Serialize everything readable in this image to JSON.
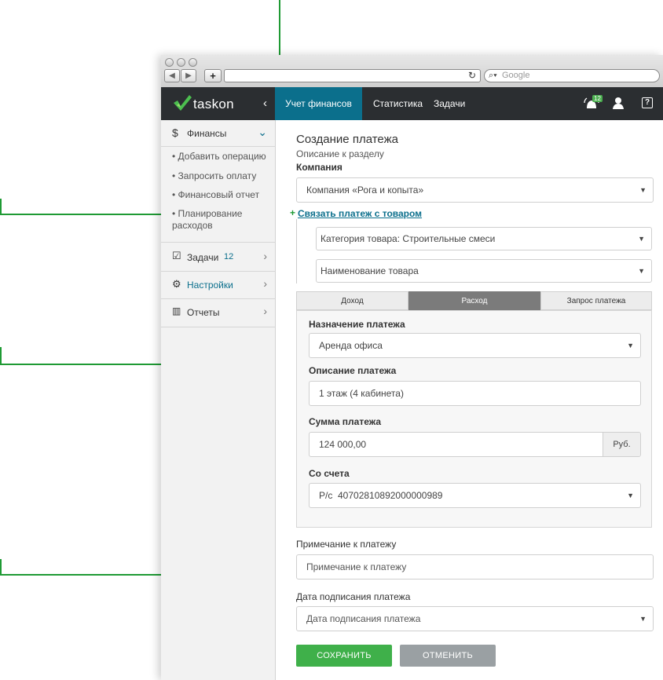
{
  "browser": {
    "search_placeholder": "Google",
    "new_tab": "+",
    "back": "◀",
    "forward": "▶"
  },
  "app": {
    "logo_text": "taskon",
    "collapse": "‹",
    "nav": [
      "Учет финансов",
      "Статистика",
      "Задачи"
    ],
    "notifications_count": "12",
    "help": "?"
  },
  "sidebar": {
    "finance": {
      "label": "Финансы",
      "icon": "dollar-icon",
      "items": [
        "Добавить операцию",
        "Запросить оплату",
        "Финансовый отчет",
        "Планирование расходов"
      ]
    },
    "tasks": {
      "label": "Задачи",
      "count": "12"
    },
    "settings": {
      "label": "Настройки"
    },
    "reports": {
      "label": "Отчеты"
    }
  },
  "form": {
    "title": "Создание платежа",
    "description": "Описание к разделу",
    "company_label": "Компания",
    "company_value": "Компания «Рога и копыта»",
    "link_product": "Связать платеж с товаром",
    "category_value": "Категория товара: Строительные смеси",
    "product_value": "Наименование товара",
    "tabs": [
      "Доход",
      "Расход",
      "Запрос платежа"
    ],
    "active_tab": "Расход",
    "purpose_label": "Назначение платежа",
    "purpose_value": "Аренда офиса",
    "desc_label": "Описание платежа",
    "desc_value": "1 этаж (4 кабинета)",
    "amount_label": "Сумма платежа",
    "amount_value": "124 000,00",
    "currency": "Руб.",
    "account_label": "Со счета",
    "account_value": "Р/с  40702810892000000989",
    "note_label": "Примечание к платежу",
    "note_placeholder": "Примечание к платежу",
    "date_label": "Дата подписания платежа",
    "date_value": "Дата подписания платежа",
    "save": "СОХРАНИТЬ",
    "cancel": "ОТМЕНИТЬ"
  },
  "colors": {
    "accent": "#0b6f8c",
    "topbar": "#2b2e31",
    "save": "#3fb04a",
    "annotation": "#1f9a34"
  }
}
